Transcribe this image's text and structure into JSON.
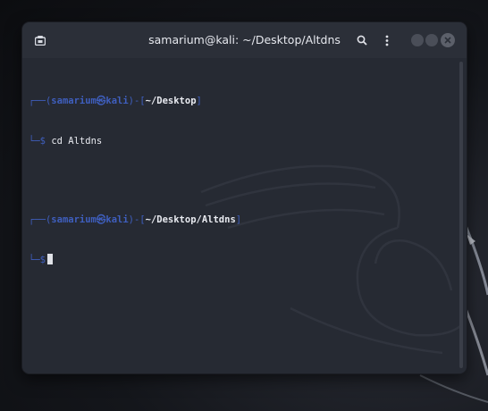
{
  "window": {
    "title": "samarium@kali: ~/Desktop/Altdns",
    "icons": {
      "new_tab": "terminal-tab-icon",
      "search": "search-icon",
      "menu": "kebab-menu-icon",
      "minimize": "minimize-icon",
      "maximize": "maximize-icon",
      "close": "close-icon"
    }
  },
  "terminal": {
    "prompts": [
      {
        "open": "┌──(",
        "user": "samarium㉿kali",
        "mid": ")-[",
        "path": "~/Desktop",
        "close": "]",
        "prefix": "└─",
        "dollar": "$",
        "command": "cd Altdns"
      },
      {
        "open": "┌──(",
        "user": "samarium㉿kali",
        "mid": ")-[",
        "path": "~/Desktop/Altdns",
        "close": "]",
        "prefix": "└─",
        "dollar": "$",
        "command": ""
      }
    ]
  },
  "colors": {
    "accent": "#3f5fbf",
    "terminal_bg": "#262a33",
    "titlebar_bg": "#2b2f38",
    "text": "#e8eaf0"
  }
}
